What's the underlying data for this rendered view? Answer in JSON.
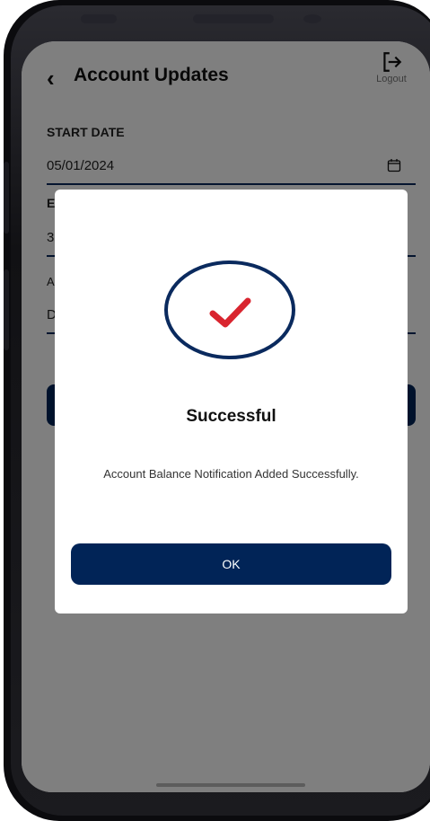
{
  "header": {
    "title": "Account Updates",
    "logout_label": "Logout"
  },
  "form": {
    "start_date_label": "START DATE",
    "start_date_value": "05/01/2024",
    "end_date_label_partial": "E",
    "end_date_value_partial": "3",
    "third_label_partial": "A",
    "third_value_partial": "D"
  },
  "dialog": {
    "title": "Successful",
    "message": "Account Balance Notification Added Successfully.",
    "ok_label": "OK"
  },
  "colors": {
    "primary": "#012457",
    "check": "#d9252f",
    "circle": "#0a2a5e"
  }
}
